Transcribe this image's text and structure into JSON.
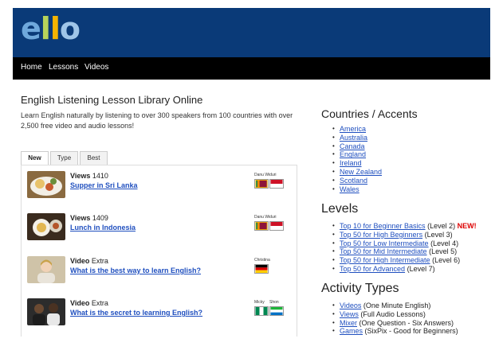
{
  "header": {
    "logo_text": "ello",
    "logo_letters": [
      "e",
      "l",
      "l",
      "o"
    ],
    "brand_color": "#0a3a78"
  },
  "nav": {
    "items": [
      "Home",
      "Lessons",
      "Videos"
    ]
  },
  "main": {
    "title": "English Listening Lesson Library Online",
    "intro": "Learn English naturally by listening to over 300 speakers from 100 countries with over 2,500 free video and audio lessons!",
    "tabs": [
      "New",
      "Type",
      "Best"
    ],
    "active_tab": "New",
    "lessons": [
      {
        "type": "Views",
        "number": "1410",
        "title": "Supper in Sri Lanka",
        "speakers": [
          "Danu Widuri"
        ],
        "thumb": "food-thumbnail"
      },
      {
        "type": "Views",
        "number": "1409",
        "title": "Lunch in Indonesia",
        "speakers": [
          "Danu Widuri"
        ],
        "thumb": "food-thumbnail"
      },
      {
        "type": "Video",
        "number": "Extra",
        "title": "What is the best way to learn English?",
        "speakers": [
          "Christina"
        ],
        "thumb": "person-thumbnail"
      },
      {
        "type": "Video",
        "number": "Extra",
        "title": "What is the secret to learning English?",
        "speakers": [
          "Micky",
          "Shon"
        ],
        "thumb": "people-thumbnail"
      }
    ]
  },
  "sidebar": {
    "countries_heading": "Countries / Accents",
    "countries": [
      "America",
      "Australia",
      "Canada",
      "England",
      "Ireland",
      "New Zealand",
      "Scotland",
      "Wales"
    ],
    "levels_heading": "Levels",
    "levels": [
      {
        "link": "Top 10 for Beginner Basics",
        "note": "(Level 2)",
        "badge": "NEW!"
      },
      {
        "link": "Top 50 for High Beginners",
        "note": "(Level 3)",
        "badge": ""
      },
      {
        "link": "Top 50 for Low Intermediate",
        "note": "(Level 4)",
        "badge": ""
      },
      {
        "link": "Top 50 for Mid Intermediate",
        "note": "(Level 5)",
        "badge": ""
      },
      {
        "link": "Top 50 for High Intermediate",
        "note": "(Level 6)",
        "badge": ""
      },
      {
        "link": "Top 50 for Advanced",
        "note": "(Level 7)",
        "badge": ""
      }
    ],
    "activity_heading": "Activity Types",
    "activities": [
      {
        "link": "Videos",
        "note": "(One Minute English)"
      },
      {
        "link": "Views",
        "note": "(Full Audio Lessons)"
      },
      {
        "link": "Mixer",
        "note": "(One Question - Six Answers)"
      },
      {
        "link": "Games",
        "note": "(SixPix - Good for Beginners)"
      }
    ]
  },
  "colors": {
    "link": "#1f4fbf",
    "new_badge": "#dd0000",
    "nav_bg": "#000000"
  }
}
